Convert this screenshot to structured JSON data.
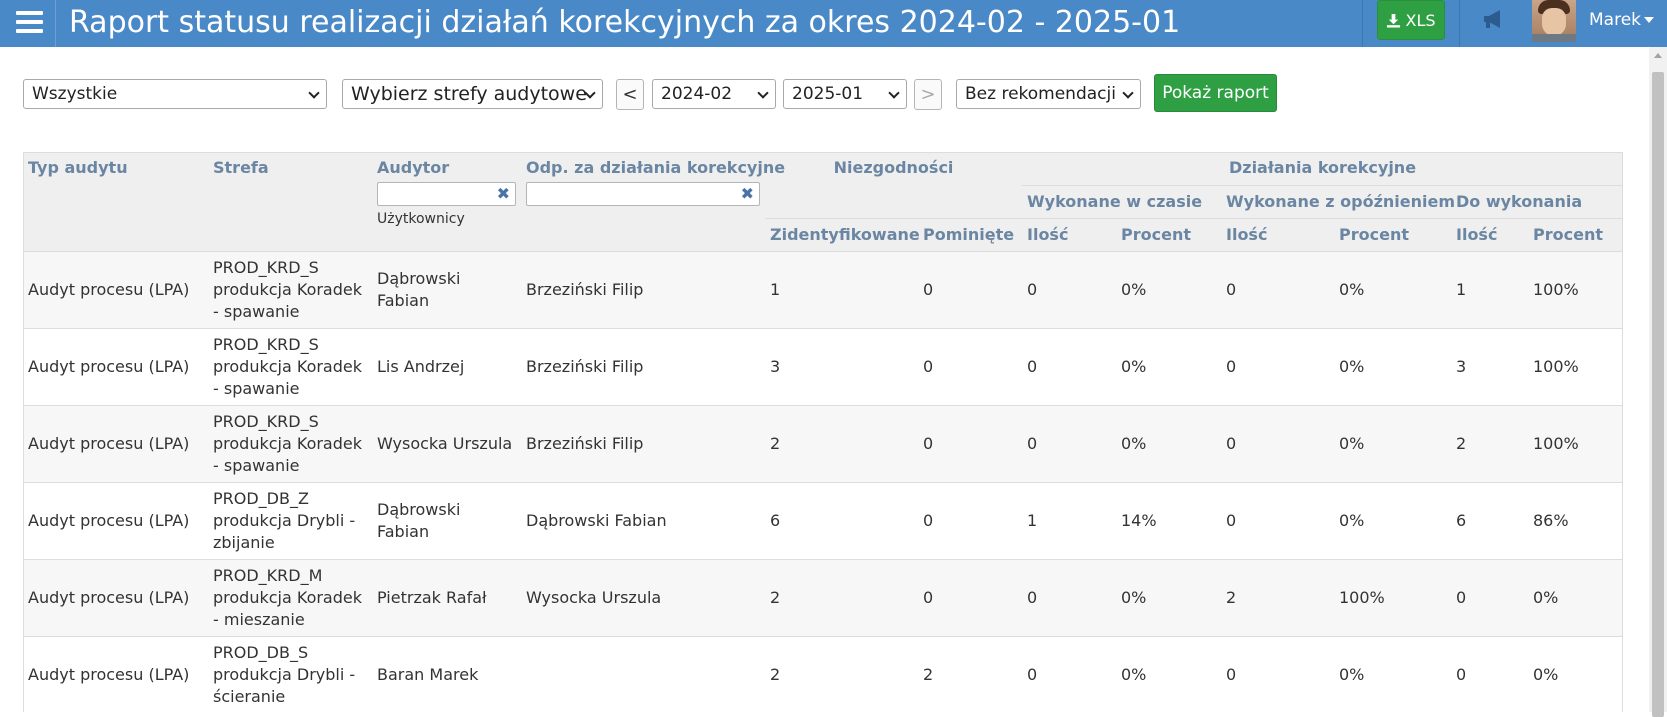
{
  "header": {
    "title": "Raport statusu realizacji działań korekcyjnych za okres 2024-02 - 2025-01",
    "xls_label": "XLS",
    "user_name": "Marek"
  },
  "filters": {
    "type_select": "Wszystkie",
    "zones_select": "Wybierz strefy audytowe",
    "prev_label": "<",
    "from_select": "2024-02",
    "to_select": "2025-01",
    "next_label": ">",
    "recommendation_select": "Bez rekomendacji",
    "show_button": "Pokaż raport"
  },
  "table": {
    "headers": {
      "audit_type": "Typ audytu",
      "zone": "Strefa",
      "auditor": "Audytor",
      "auditor_sub": "Użytkownicy",
      "responsible": "Odp. za działania korekcyjne",
      "nonconformities": "Niezgodności",
      "corrective_actions": "Działania korekcyjne",
      "done_on_time": "Wykonane w czasie",
      "done_late": "Wykonane z opóźnieniem",
      "to_do": "Do wykonania",
      "identified": "Zidentyfikowane",
      "skipped": "Pominięte",
      "qty1": "Ilość",
      "pct1": "Procent",
      "qty2": "Ilość",
      "pct2": "Procent",
      "qty3": "Ilość",
      "pct3": "Procent"
    },
    "rows": [
      {
        "type": "Audyt procesu (LPA)",
        "zone_code": "PROD_KRD_S",
        "zone_name": "produkcja Koradek - spawanie",
        "auditor": "Dąbrowski Fabian",
        "responsible": "Brzeziński Filip",
        "identified": "1",
        "skipped": "0",
        "ontime_qty": "0",
        "ontime_pct": "0%",
        "late_qty": "0",
        "late_pct": "0%",
        "todo_qty": "1",
        "todo_pct": "100%"
      },
      {
        "type": "Audyt procesu (LPA)",
        "zone_code": "PROD_KRD_S",
        "zone_name": "produkcja Koradek - spawanie",
        "auditor": "Lis Andrzej",
        "responsible": "Brzeziński Filip",
        "identified": "3",
        "skipped": "0",
        "ontime_qty": "0",
        "ontime_pct": "0%",
        "late_qty": "0",
        "late_pct": "0%",
        "todo_qty": "3",
        "todo_pct": "100%"
      },
      {
        "type": "Audyt procesu (LPA)",
        "zone_code": "PROD_KRD_S",
        "zone_name": "produkcja Koradek - spawanie",
        "auditor": "Wysocka Urszula",
        "responsible": "Brzeziński Filip",
        "identified": "2",
        "skipped": "0",
        "ontime_qty": "0",
        "ontime_pct": "0%",
        "late_qty": "0",
        "late_pct": "0%",
        "todo_qty": "2",
        "todo_pct": "100%"
      },
      {
        "type": "Audyt procesu (LPA)",
        "zone_code": "PROD_DB_Z",
        "zone_name": "produkcja Drybli - zbijanie",
        "auditor": "Dąbrowski Fabian",
        "responsible": "Dąbrowski Fabian",
        "identified": "6",
        "skipped": "0",
        "ontime_qty": "1",
        "ontime_pct": "14%",
        "late_qty": "0",
        "late_pct": "0%",
        "todo_qty": "6",
        "todo_pct": "86%"
      },
      {
        "type": "Audyt procesu (LPA)",
        "zone_code": "PROD_KRD_M",
        "zone_name": "produkcja Koradek - mieszanie",
        "auditor": "Pietrzak Rafał",
        "responsible": "Wysocka Urszula",
        "identified": "2",
        "skipped": "0",
        "ontime_qty": "0",
        "ontime_pct": "0%",
        "late_qty": "2",
        "late_pct": "100%",
        "todo_qty": "0",
        "todo_pct": "0%"
      },
      {
        "type": "Audyt procesu (LPA)",
        "zone_code": "PROD_DB_S",
        "zone_name": "produkcja Drybli - ścieranie",
        "auditor": "Baran Marek",
        "responsible": "",
        "identified": "2",
        "skipped": "2",
        "ontime_qty": "0",
        "ontime_pct": "0%",
        "late_qty": "0",
        "late_pct": "0%",
        "todo_qty": "0",
        "todo_pct": "0%"
      }
    ]
  }
}
